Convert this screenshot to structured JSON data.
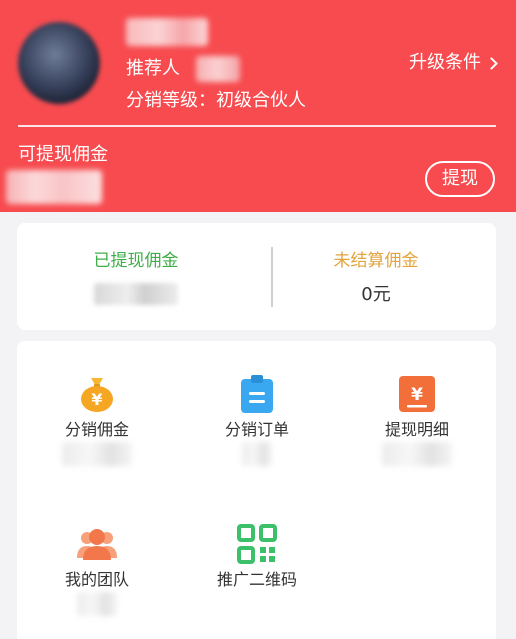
{
  "header": {
    "referrer_label": "推荐人",
    "level_text": "分销等级：初级合伙人",
    "upgrade_label": "升级条件",
    "withdrawable_label": "可提现佣金",
    "withdraw_button": "提现"
  },
  "stats": {
    "withdrawn_label": "已提现佣金",
    "unsettled_label": "未结算佣金",
    "unsettled_value": "0元"
  },
  "menu": {
    "items": [
      {
        "label": "分销佣金",
        "icon": "money-bag-icon",
        "color": "#f5a623"
      },
      {
        "label": "分销订单",
        "icon": "clipboard-icon",
        "color": "#3aa8f0"
      },
      {
        "label": "提现明细",
        "icon": "yen-receipt-icon",
        "color": "#f26f3a"
      },
      {
        "label": "我的团队",
        "icon": "team-icon",
        "color": "#f2784b"
      },
      {
        "label": "推广二维码",
        "icon": "qr-code-icon",
        "color": "#3cc06a"
      }
    ]
  },
  "colors": {
    "header_bg": "#f74b4f",
    "withdrawn_green": "#3fae49",
    "unsettled_orange": "#e3a33d"
  }
}
